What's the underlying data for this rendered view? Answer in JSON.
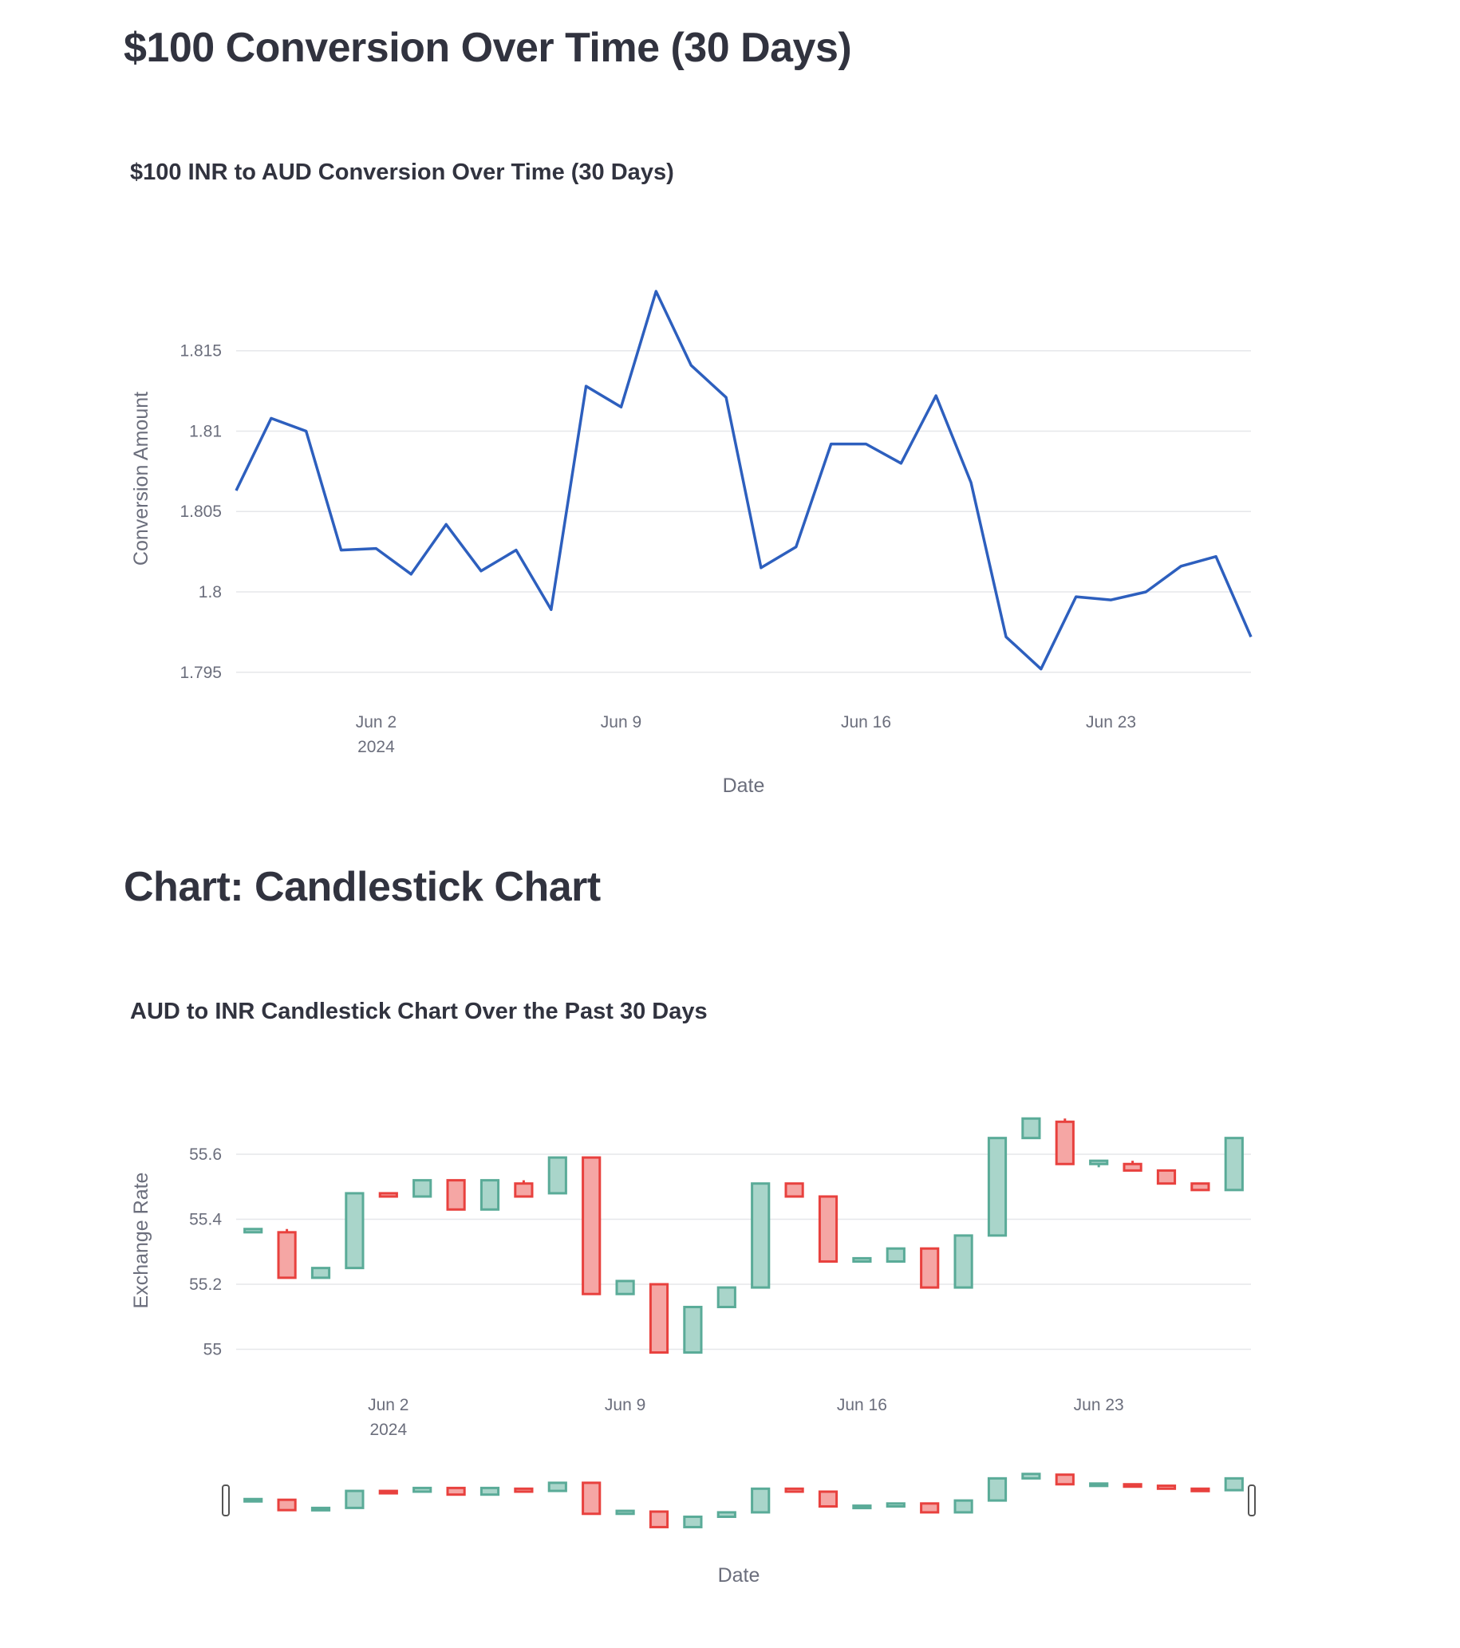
{
  "page": {
    "section1_title": "$100 Conversion Over Time (30 Days)",
    "section2_title": "Chart: Candlestick Chart"
  },
  "chart_data": [
    {
      "type": "line",
      "title": "$100 INR to AUD Conversion Over Time (30 Days)",
      "xlabel": "Date",
      "ylabel": "Conversion Amount",
      "x": [
        "2024-05-29",
        "2024-05-30",
        "2024-05-31",
        "2024-06-01",
        "2024-06-02",
        "2024-06-03",
        "2024-06-04",
        "2024-06-05",
        "2024-06-06",
        "2024-06-07",
        "2024-06-08",
        "2024-06-09",
        "2024-06-10",
        "2024-06-11",
        "2024-06-12",
        "2024-06-13",
        "2024-06-14",
        "2024-06-15",
        "2024-06-16",
        "2024-06-17",
        "2024-06-18",
        "2024-06-19",
        "2024-06-20",
        "2024-06-21",
        "2024-06-22",
        "2024-06-23",
        "2024-06-24",
        "2024-06-25",
        "2024-06-26",
        "2024-06-27"
      ],
      "series": [
        {
          "values": [
            1.8063,
            1.8108,
            1.81,
            1.8026,
            1.8027,
            1.8011,
            1.8042,
            1.8013,
            1.8026,
            1.7989,
            1.8128,
            1.8115,
            1.8187,
            1.8141,
            1.8121,
            1.8015,
            1.8028,
            1.8092,
            1.8092,
            1.808,
            1.8122,
            1.8068,
            1.7972,
            1.7952,
            1.7997,
            1.7995,
            1.8,
            1.8016,
            1.8022,
            1.7972
          ]
        }
      ],
      "ylim": [
        1.7935,
        1.8197
      ],
      "yticks": [
        "1.795",
        "1.8",
        "1.805",
        "1.81",
        "1.815"
      ],
      "xticks": [
        {
          "date": "2024-06-02",
          "label": "Jun 2",
          "sublabel": "2024"
        },
        {
          "date": "2024-06-09",
          "label": "Jun 9",
          "sublabel": ""
        },
        {
          "date": "2024-06-16",
          "label": "Jun 16",
          "sublabel": ""
        },
        {
          "date": "2024-06-23",
          "label": "Jun 23",
          "sublabel": ""
        }
      ],
      "grid": true,
      "colors": {
        "line": "#2d5fbe",
        "grid": "#e6e7ea"
      }
    },
    {
      "type": "candlestick",
      "title": "AUD to INR Candlestick Chart Over the Past 30 Days",
      "xlabel": "Date",
      "ylabel": "Exchange Rate",
      "x": [
        "2024-05-29",
        "2024-05-30",
        "2024-05-31",
        "2024-06-01",
        "2024-06-02",
        "2024-06-03",
        "2024-06-04",
        "2024-06-05",
        "2024-06-06",
        "2024-06-07",
        "2024-06-08",
        "2024-06-09",
        "2024-06-10",
        "2024-06-11",
        "2024-06-12",
        "2024-06-13",
        "2024-06-14",
        "2024-06-15",
        "2024-06-16",
        "2024-06-17",
        "2024-06-18",
        "2024-06-19",
        "2024-06-20",
        "2024-06-21",
        "2024-06-22",
        "2024-06-23",
        "2024-06-24",
        "2024-06-25",
        "2024-06-26",
        "2024-06-27"
      ],
      "open": [
        55.36,
        55.36,
        55.22,
        55.25,
        55.48,
        55.47,
        55.52,
        55.43,
        55.51,
        55.48,
        55.59,
        55.17,
        55.2,
        54.99,
        55.13,
        55.19,
        55.51,
        55.47,
        55.27,
        55.27,
        55.31,
        55.19,
        55.35,
        55.65,
        55.7,
        55.57,
        55.57,
        55.55,
        55.51,
        55.49
      ],
      "high": [
        55.37,
        55.37,
        55.25,
        55.48,
        55.48,
        55.52,
        55.52,
        55.52,
        55.52,
        55.59,
        55.59,
        55.21,
        55.2,
        55.13,
        55.19,
        55.51,
        55.51,
        55.47,
        55.28,
        55.31,
        55.31,
        55.35,
        55.65,
        55.71,
        55.71,
        55.58,
        55.58,
        55.55,
        55.51,
        55.65
      ],
      "low": [
        55.36,
        55.22,
        55.22,
        55.25,
        55.47,
        55.47,
        55.43,
        55.43,
        55.47,
        55.48,
        55.17,
        55.17,
        54.99,
        54.99,
        55.13,
        55.19,
        55.47,
        55.27,
        55.27,
        55.27,
        55.19,
        55.19,
        55.35,
        55.65,
        55.57,
        55.56,
        55.55,
        55.51,
        55.49,
        55.49
      ],
      "close": [
        55.37,
        55.22,
        55.25,
        55.48,
        55.47,
        55.52,
        55.43,
        55.52,
        55.47,
        55.59,
        55.17,
        55.21,
        54.99,
        55.13,
        55.19,
        55.51,
        55.47,
        55.27,
        55.28,
        55.31,
        55.19,
        55.35,
        55.65,
        55.71,
        55.57,
        55.58,
        55.55,
        55.51,
        55.49,
        55.65
      ],
      "ylim": [
        54.93,
        55.74
      ],
      "yticks": [
        "55",
        "55.2",
        "55.4",
        "55.6"
      ],
      "xticks": [
        {
          "date": "2024-06-02",
          "label": "Jun 2",
          "sublabel": "2024"
        },
        {
          "date": "2024-06-09",
          "label": "Jun 9",
          "sublabel": ""
        },
        {
          "date": "2024-06-16",
          "label": "Jun 16",
          "sublabel": ""
        },
        {
          "date": "2024-06-23",
          "label": "Jun 23",
          "sublabel": ""
        }
      ],
      "grid": true,
      "rangeslider": true,
      "colors": {
        "increasing_line": "#5aab98",
        "increasing_fill": "#a9d5ca",
        "decreasing_line": "#e8413e",
        "decreasing_fill": "#f5a6a4",
        "grid": "#e6e7ea"
      }
    }
  ]
}
